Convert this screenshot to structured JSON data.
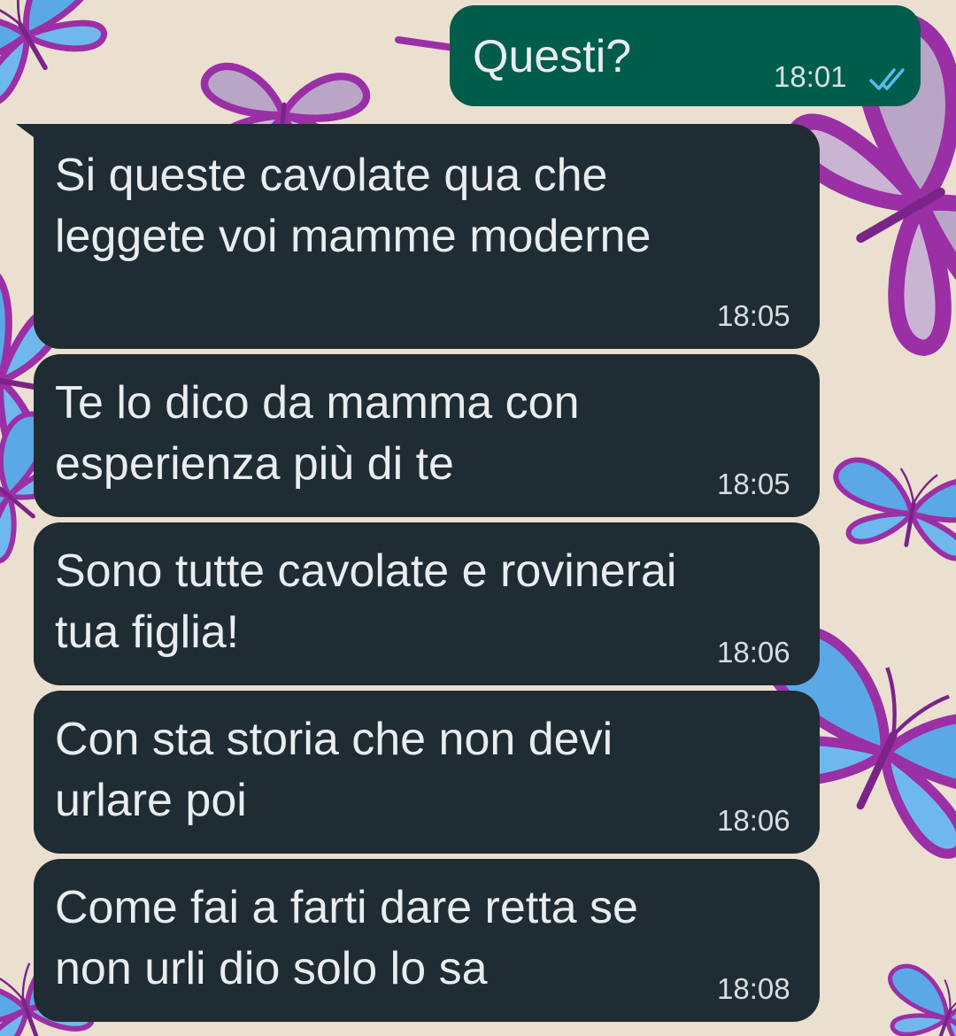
{
  "chat": {
    "messages": [
      {
        "direction": "outgoing",
        "text": "Questi?",
        "time": "18:01",
        "status": "read"
      },
      {
        "direction": "incoming",
        "text": "Si queste cavolate qua che\nleggete voi mamme moderne",
        "time": "18:05"
      },
      {
        "direction": "incoming",
        "text": "Te lo dico da mamma con\nesperienza più di te",
        "time": "18:05"
      },
      {
        "direction": "incoming",
        "text": "Sono tutte cavolate e rovinerai\ntua figlia!",
        "time": "18:06"
      },
      {
        "direction": "incoming",
        "text": "Con sta storia che non devi\nurlare poi",
        "time": "18:06"
      },
      {
        "direction": "incoming",
        "text": "Come fai a farti dare retta se\nnon urli dio solo lo sa",
        "time": "18:08"
      }
    ]
  },
  "theme": {
    "wallpaper_color": "#ebe0d0",
    "outgoing_bubble": "#005c4b",
    "incoming_bubble": "#202c33",
    "text_color": "#e9edef",
    "read_tick_color": "#53bdeb",
    "wallpaper_motif": "butterflies",
    "butterfly_colors": [
      "#9b2fa6",
      "#5aa9e6"
    ]
  },
  "icons": {
    "read_receipt": "double-check-icon"
  }
}
